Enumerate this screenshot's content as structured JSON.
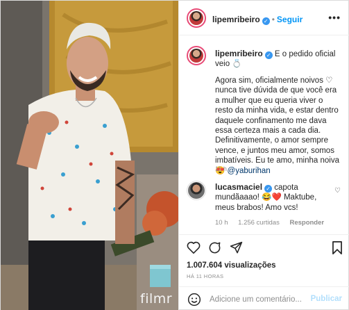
{
  "header": {
    "username": "lipemribeiro",
    "separator": "•",
    "follow_label": "Seguir",
    "more_label": "•••"
  },
  "caption": {
    "username": "lipemribeiro",
    "title": "E o pedido oficial veio 💍",
    "body_parts": [
      "Agora sim, oficialmente noivos ♡ nunca tive dúvida de que você era a mulher que eu queria viver o resto da minha vida, e estar dentro daquele confinamento me dava essa certeza mais a cada dia. Definitivamente, o amor sempre vence, e juntos meu amor, somos imbatíveis. Eu te amo, minha noiva 😍 "
    ],
    "mention": "@yaburihan",
    "time": "11 h"
  },
  "comment": {
    "username": "lucasmaciel",
    "text": " capota mundãaaao! 😂❤️ Maktube, meus brabos! Amo vcs!",
    "time": "10 h",
    "likes": "1.256 curtidas",
    "reply_label": "Responder"
  },
  "stats": {
    "views": "1.007.604 visualizações",
    "date": "HÁ 11 HORAS"
  },
  "add_comment": {
    "placeholder": "Adicione um comentário...",
    "publish_label": "Publicar"
  },
  "media": {
    "watermark": "filmr"
  },
  "icons": {
    "like": "heart-icon",
    "comment": "comment-icon",
    "share": "share-icon",
    "save": "bookmark-icon",
    "emoji": "emoji-icon",
    "verified": "verified-badge-icon"
  },
  "colors": {
    "link": "#0095f6",
    "mention": "#00376b",
    "verified": "#3897f0",
    "muted": "#8e8e8e",
    "publish_disabled": "#b2dffc"
  }
}
